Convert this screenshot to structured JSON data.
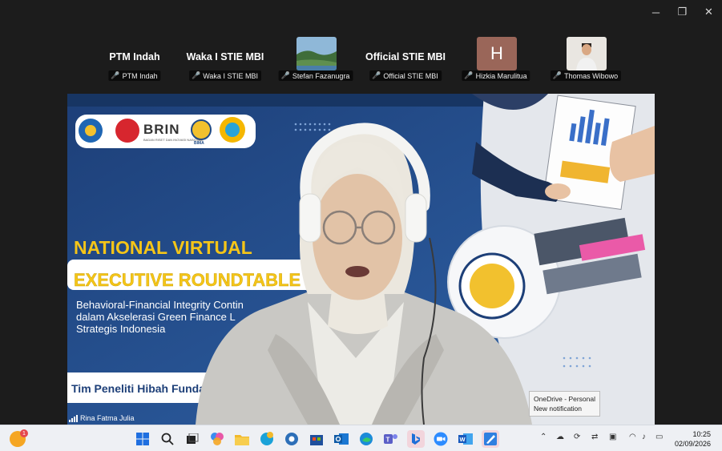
{
  "window_controls": {
    "minimize": "─",
    "restore": "❐",
    "close": "✕"
  },
  "participants": [
    {
      "name": "PTM Indah",
      "label": "PTM Indah",
      "kind": "name"
    },
    {
      "name": "Waka I STIE MBI",
      "label": "Waka I STIE MBI",
      "kind": "name"
    },
    {
      "name": "",
      "label": "Stefan Fazanugra",
      "kind": "photo-landscape"
    },
    {
      "name": "Official STIE MBI",
      "label": "Official STIE MBI",
      "kind": "name"
    },
    {
      "name": "",
      "label": "Hizkia Marulitua",
      "kind": "letter",
      "letter": "H"
    },
    {
      "name": "",
      "label": "Thomas Wibowo",
      "kind": "photo-person"
    }
  ],
  "mic_muted_glyph": "🎤",
  "slide": {
    "logo_brin": "BRIN",
    "logo_brin_sub": "BADAN RISET DAN INOVASI NASIONAL",
    "logo_bima": "BIMA",
    "title_line1": "NATIONAL VIRTUAL",
    "title_line2": "EXECUTIVE ROUNDTABLE",
    "subtitle_line1": "Behavioral-Financial Integrity Contin",
    "subtitle_line2": "dalam Akselerasi Green Finance L",
    "subtitle_line3": "Strategis Indonesia",
    "team_line": "Tim Peneliti Hibah  Funda"
  },
  "active_speaker": "Rina Fatma Julia",
  "notification": {
    "line1": "OneDrive - Personal",
    "line2": "New notification"
  },
  "clock": {
    "time": "10:25",
    "date": "02/09/2026"
  },
  "colors": {
    "slide_blue": "#1f4a86",
    "title_yellow": "#f5c518",
    "mic_red": "#e5484d"
  }
}
